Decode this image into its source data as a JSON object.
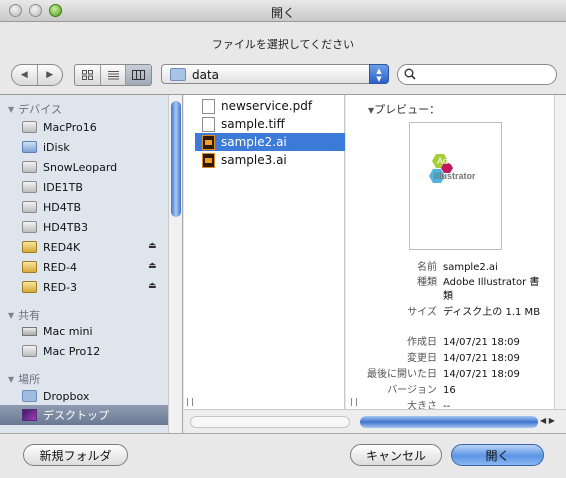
{
  "window": {
    "title": "開く",
    "prompt": "ファイルを選択してください"
  },
  "toolbar": {
    "back_icon": "back-arrow-icon",
    "forward_icon": "forward-arrow-icon",
    "view_modes": [
      "icon-view",
      "list-view",
      "column-view"
    ],
    "selected_view": "column-view",
    "path_popup": {
      "label": "data",
      "icon": "folder-icon"
    },
    "search": {
      "value": "",
      "placeholder": ""
    }
  },
  "sidebar": {
    "sections": [
      {
        "header": "デバイス",
        "items": [
          {
            "label": "MacPro16",
            "icon": "hard-disk-icon"
          },
          {
            "label": "iDisk",
            "icon": "idisk-icon"
          },
          {
            "label": "SnowLeopard",
            "icon": "hard-disk-icon"
          },
          {
            "label": "IDE1TB",
            "icon": "hard-disk-icon"
          },
          {
            "label": "HD4TB",
            "icon": "hard-disk-icon"
          },
          {
            "label": "HD4TB3",
            "icon": "hard-disk-icon"
          },
          {
            "label": "RED4K",
            "icon": "external-disk-icon",
            "eject": true
          },
          {
            "label": "RED-4",
            "icon": "external-disk-icon",
            "eject": true
          },
          {
            "label": "RED-3",
            "icon": "external-disk-icon",
            "eject": true
          }
        ]
      },
      {
        "header": "共有",
        "items": [
          {
            "label": "Mac mini",
            "icon": "mac-mini-icon"
          },
          {
            "label": "Mac Pro12",
            "icon": "computer-icon"
          }
        ]
      },
      {
        "header": "場所",
        "items": [
          {
            "label": "Dropbox",
            "icon": "folder-icon"
          },
          {
            "label": "デスクトップ",
            "icon": "desktop-icon",
            "selected": true
          }
        ]
      }
    ]
  },
  "files": [
    {
      "name": "newservice.pdf",
      "icon": "pdf-document-icon"
    },
    {
      "name": "sample.tiff",
      "icon": "tiff-document-icon"
    },
    {
      "name": "sample2.ai",
      "icon": "illustrator-file-icon",
      "selected": true
    },
    {
      "name": "sample3.ai",
      "icon": "illustrator-file-icon"
    }
  ],
  "preview": {
    "label": "プレビュー：",
    "logo_text_line1": "Adobe",
    "logo_text_line2": "Illustrator",
    "meta": [
      {
        "key": "名前",
        "value": "sample2.ai"
      },
      {
        "key": "種類",
        "value": "Adobe Illustrator 書類"
      },
      {
        "key": "サイズ",
        "value": "ディスク上の 1.1 MB"
      },
      {
        "key": "作成日",
        "value": "14/07/21 18:09"
      },
      {
        "key": "変更日",
        "value": "14/07/21 18:09"
      },
      {
        "key": "最後に開いた日",
        "value": "14/07/21 18:09"
      },
      {
        "key": "バージョン",
        "value": "16"
      },
      {
        "key": "大きさ",
        "value": "--"
      }
    ]
  },
  "buttons": {
    "new_folder": "新規フォルダ",
    "cancel": "キャンセル",
    "open": "開く"
  },
  "colors": {
    "selection": "#3d7bd9",
    "sidebar_bg": "#dfe5ed",
    "default_button": "#5c94e4"
  }
}
